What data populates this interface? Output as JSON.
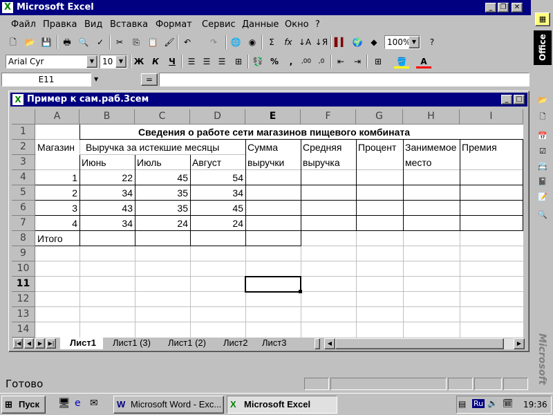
{
  "app": {
    "title": "Microsoft Excel"
  },
  "menu": [
    "Файл",
    "Правка",
    "Вид",
    "Вставка",
    "Формат",
    "Сервис",
    "Данные",
    "Окно",
    "?"
  ],
  "toolbar": {
    "zoom": "100%",
    "font": "Arial Cyr",
    "size": "10",
    "bold": "Ж",
    "italic": "К",
    "underline": "Ч"
  },
  "formula": {
    "namebox": "E11",
    "equals": "="
  },
  "office_bar": {
    "label": "Office",
    "brand": "Microsoft"
  },
  "workbook": {
    "title": "Пример к сам.раб.3сем"
  },
  "columns": [
    "A",
    "B",
    "C",
    "D",
    "E",
    "F",
    "G",
    "H",
    "I"
  ],
  "rows": [
    "1",
    "2",
    "3",
    "4",
    "5",
    "6",
    "7",
    "8",
    "9",
    "10",
    "11",
    "12",
    "13",
    "14"
  ],
  "sheet": {
    "title": "Сведения о работе сети магазинов пищевого комбината",
    "h_shop": "Магазин",
    "h_revenue": "Выручка за истекшие месяцы",
    "h_sum1": "Сумма",
    "h_sum2": "выручки",
    "h_avg1": "Средняя",
    "h_avg2": "выручка",
    "h_pct": "Процент",
    "h_place1": "Занимемое",
    "h_place2": "место",
    "h_bonus": "Премия",
    "m1": "Июнь",
    "m2": "Июль",
    "m3": "Август",
    "data": [
      [
        "1",
        "22",
        "45",
        "54"
      ],
      [
        "2",
        "34",
        "35",
        "34"
      ],
      [
        "3",
        "43",
        "35",
        "45"
      ],
      [
        "4",
        "34",
        "24",
        "24"
      ]
    ],
    "total": "Итого"
  },
  "tabs": [
    "Лист1",
    "Лист1 (3)",
    "Лист1 (2)",
    "Лист2",
    "Лист3"
  ],
  "status": {
    "text": "Готово"
  },
  "taskbar": {
    "start": "Пуск",
    "word": "Microsoft Word - Exc...",
    "excel": "Microsoft Excel",
    "lang": "Ru",
    "clock": "19:36"
  }
}
